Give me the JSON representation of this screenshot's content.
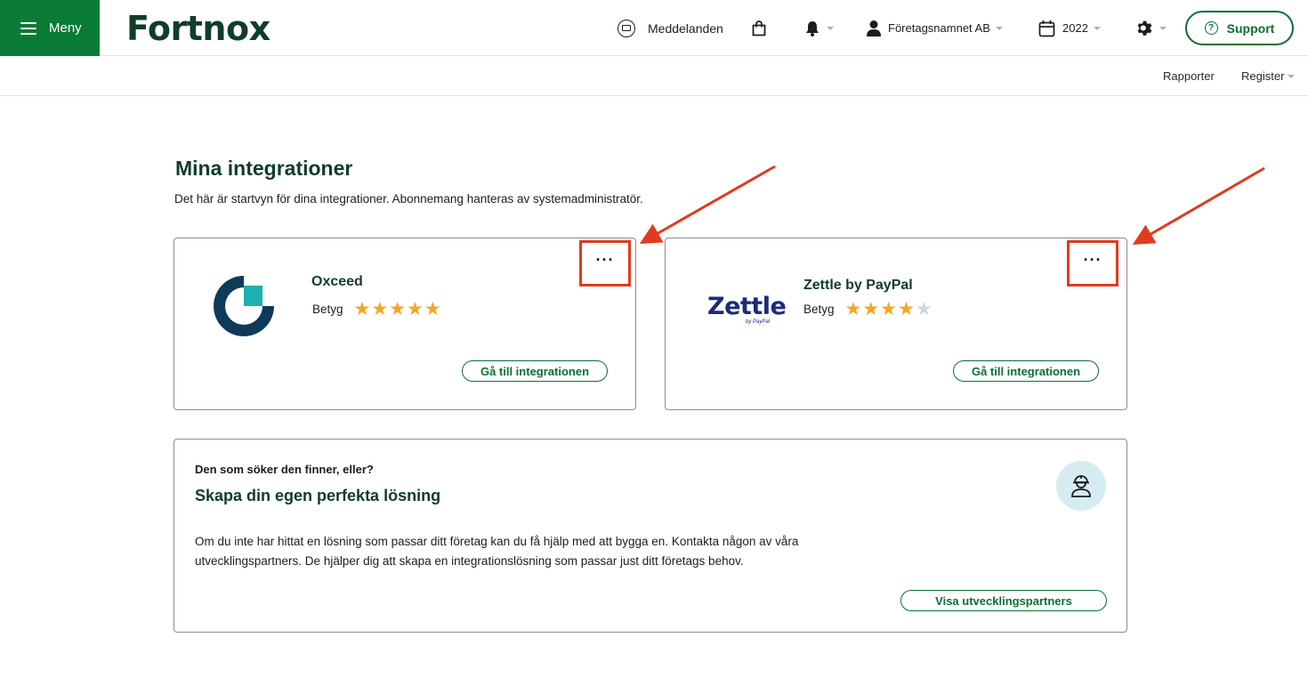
{
  "header": {
    "menu_label": "Meny",
    "logo_text": "Fortnox",
    "messages_label": "Meddelanden",
    "company_label": "Företagsnamnet AB",
    "year_label": "2022",
    "support_label": "Support",
    "support_icon_text": "?"
  },
  "subnav": {
    "reports_label": "Rapporter",
    "register_label": "Register"
  },
  "main": {
    "title": "Mina integrationer",
    "description": "Det här är startvyn för dina integrationer. Abonnemang hanteras av systemadministratör."
  },
  "integrations": [
    {
      "name": "Oxceed",
      "rating_label": "Betyg",
      "rating": 5,
      "rating_max": 5,
      "more_label": "···",
      "button_label": "Gå till integrationen"
    },
    {
      "name": "Zettle by PayPal",
      "rating_label": "Betyg",
      "rating": 4,
      "rating_max": 5,
      "logo_word": "Zettle",
      "logo_sub": "by PayPal",
      "more_label": "···",
      "button_label": "Gå till integrationen"
    }
  ],
  "promo": {
    "kicker": "Den som söker den finner, eller?",
    "title": "Skapa din egen perfekta lösning",
    "text": "Om du inte har hittat en lösning som passar ditt företag kan du få hjälp med att bygga en. Kontakta någon av våra utvecklingspartners. De hjälper dig att skapa en integrationslösning som passar just ditt företags behov.",
    "button_label": "Visa utvecklingspartners"
  },
  "colors": {
    "brand_green": "#0a7a37",
    "dark_green": "#103d28",
    "star": "#f5a623",
    "highlight_red": "#e03b1f"
  },
  "icons": [
    "hamburger-icon",
    "message-icon",
    "bag-icon",
    "bell-icon",
    "user-icon",
    "calendar-icon",
    "gear-icon",
    "question-icon",
    "worker-icon"
  ]
}
